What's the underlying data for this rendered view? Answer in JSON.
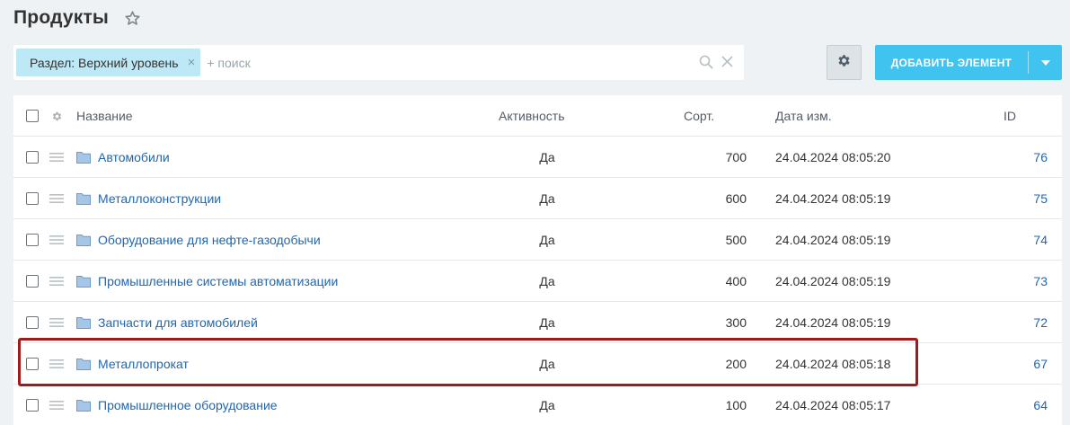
{
  "header": {
    "title": "Продукты"
  },
  "filter": {
    "chip_label": "Раздел: Верхний уровень",
    "chip_close": "×",
    "search_placeholder": "+ поиск"
  },
  "toolbar": {
    "add_label": "ДОБАВИТЬ ЭЛЕМЕНТ"
  },
  "grid": {
    "columns": {
      "name": "Название",
      "active": "Активность",
      "sort": "Сорт.",
      "date": "Дата изм.",
      "id": "ID"
    },
    "rows": [
      {
        "name": "Автомобили",
        "active": "Да",
        "sort": "700",
        "date": "24.04.2024 08:05:20",
        "id": "76"
      },
      {
        "name": "Металлоконструкции",
        "active": "Да",
        "sort": "600",
        "date": "24.04.2024 08:05:19",
        "id": "75"
      },
      {
        "name": "Оборудование для нефте-газодобычи",
        "active": "Да",
        "sort": "500",
        "date": "24.04.2024 08:05:19",
        "id": "74"
      },
      {
        "name": "Промышленные системы автоматизации",
        "active": "Да",
        "sort": "400",
        "date": "24.04.2024 08:05:19",
        "id": "73"
      },
      {
        "name": "Запчасти для автомобилей",
        "active": "Да",
        "sort": "300",
        "date": "24.04.2024 08:05:19",
        "id": "72"
      },
      {
        "name": "Металлопрокат",
        "active": "Да",
        "sort": "200",
        "date": "24.04.2024 08:05:18",
        "id": "67"
      },
      {
        "name": "Промышленное оборудование",
        "active": "Да",
        "sort": "100",
        "date": "24.04.2024 08:05:17",
        "id": "64"
      }
    ]
  },
  "colors": {
    "accent": "#40c4ef",
    "link": "#2067b0",
    "chip": "#bde9f6",
    "highlight": "#a01b1b",
    "background": "#eef2f4"
  },
  "icons": {
    "star": "star-icon",
    "search": "search-icon",
    "clear": "close-icon",
    "gear": "gear-icon",
    "chevron": "chevron-down-icon",
    "folder": "folder-icon",
    "drag": "drag-handle-icon"
  }
}
